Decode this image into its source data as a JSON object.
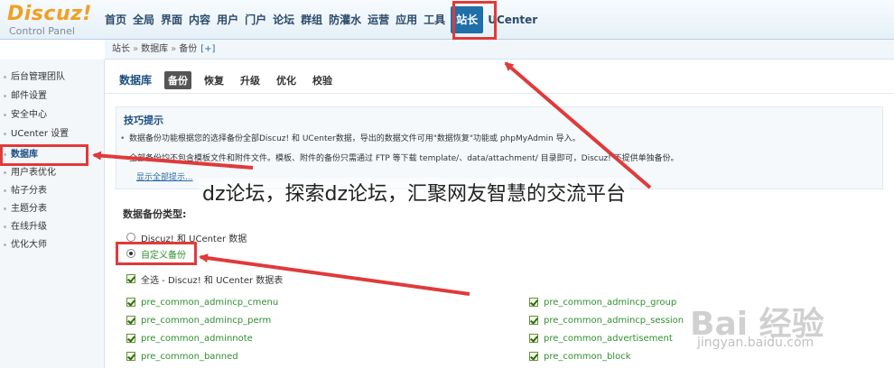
{
  "logo": {
    "brand": "Discuz!",
    "subtitle": "Control Panel"
  },
  "topnav": {
    "items": [
      {
        "label": "首页"
      },
      {
        "label": "全局"
      },
      {
        "label": "界面"
      },
      {
        "label": "内容"
      },
      {
        "label": "用户"
      },
      {
        "label": "门户"
      },
      {
        "label": "论坛"
      },
      {
        "label": "群组"
      },
      {
        "label": "防灌水"
      },
      {
        "label": "运营"
      },
      {
        "label": "应用"
      },
      {
        "label": "工具"
      },
      {
        "label": "站长",
        "active": true
      },
      {
        "label": "UCenter"
      }
    ]
  },
  "breadcrumb": {
    "root": "站长",
    "section": "数据库",
    "page": "备份",
    "add": "[+]"
  },
  "sidebar": {
    "items": [
      {
        "label": "后台管理团队"
      },
      {
        "label": "邮件设置"
      },
      {
        "label": "安全中心"
      },
      {
        "label": "UCenter 设置"
      },
      {
        "label": "数据库",
        "active": true
      },
      {
        "label": "用户表优化"
      },
      {
        "label": "帖子分表"
      },
      {
        "label": "主题分表"
      },
      {
        "label": "在线升级"
      },
      {
        "label": "优化大师"
      }
    ]
  },
  "subnav": {
    "title": "数据库",
    "tabs": [
      {
        "label": "备份",
        "active": true
      },
      {
        "label": "恢复"
      },
      {
        "label": "升级"
      },
      {
        "label": "优化"
      },
      {
        "label": "校验"
      }
    ]
  },
  "tips": {
    "title": "技巧提示",
    "line1": "数据备份功能根据您的选择备份全部Discuz! 和 UCenter数据，导出的数据文件可用\"数据恢复\"功能或 phpMyAdmin 导入。",
    "line2": "全部备份均不包含模板文件和附件文件。模板、附件的备份只需通过 FTP 等下载 template/、data/attachment/ 目录即可，Discuz! 不提供单独备份。",
    "more": "显示全部提示..."
  },
  "backup_type": {
    "title": "数据备份类型:",
    "option_all": "Discuz! 和 UCenter 数据",
    "option_custom": "自定义备份",
    "select_all": "全选 - Discuz! 和 UCenter 数据表"
  },
  "tables": {
    "left": [
      "pre_common_admincp_cmenu",
      "pre_common_admincp_perm",
      "pre_common_adminnote",
      "pre_common_banned"
    ],
    "right": [
      "pre_common_admincp_group",
      "pre_common_admincp_session",
      "pre_common_advertisement",
      "pre_common_block"
    ]
  },
  "caption": "dz论坛，探索dz论坛，汇聚网友智慧的交流平台",
  "watermark": {
    "logo": "Bai 经验",
    "url": "jingyan.baidu.com"
  },
  "colors": {
    "highlight": "#e03a3a",
    "nav_active": "#1f6fa8",
    "table_name": "#2f8f2f"
  }
}
